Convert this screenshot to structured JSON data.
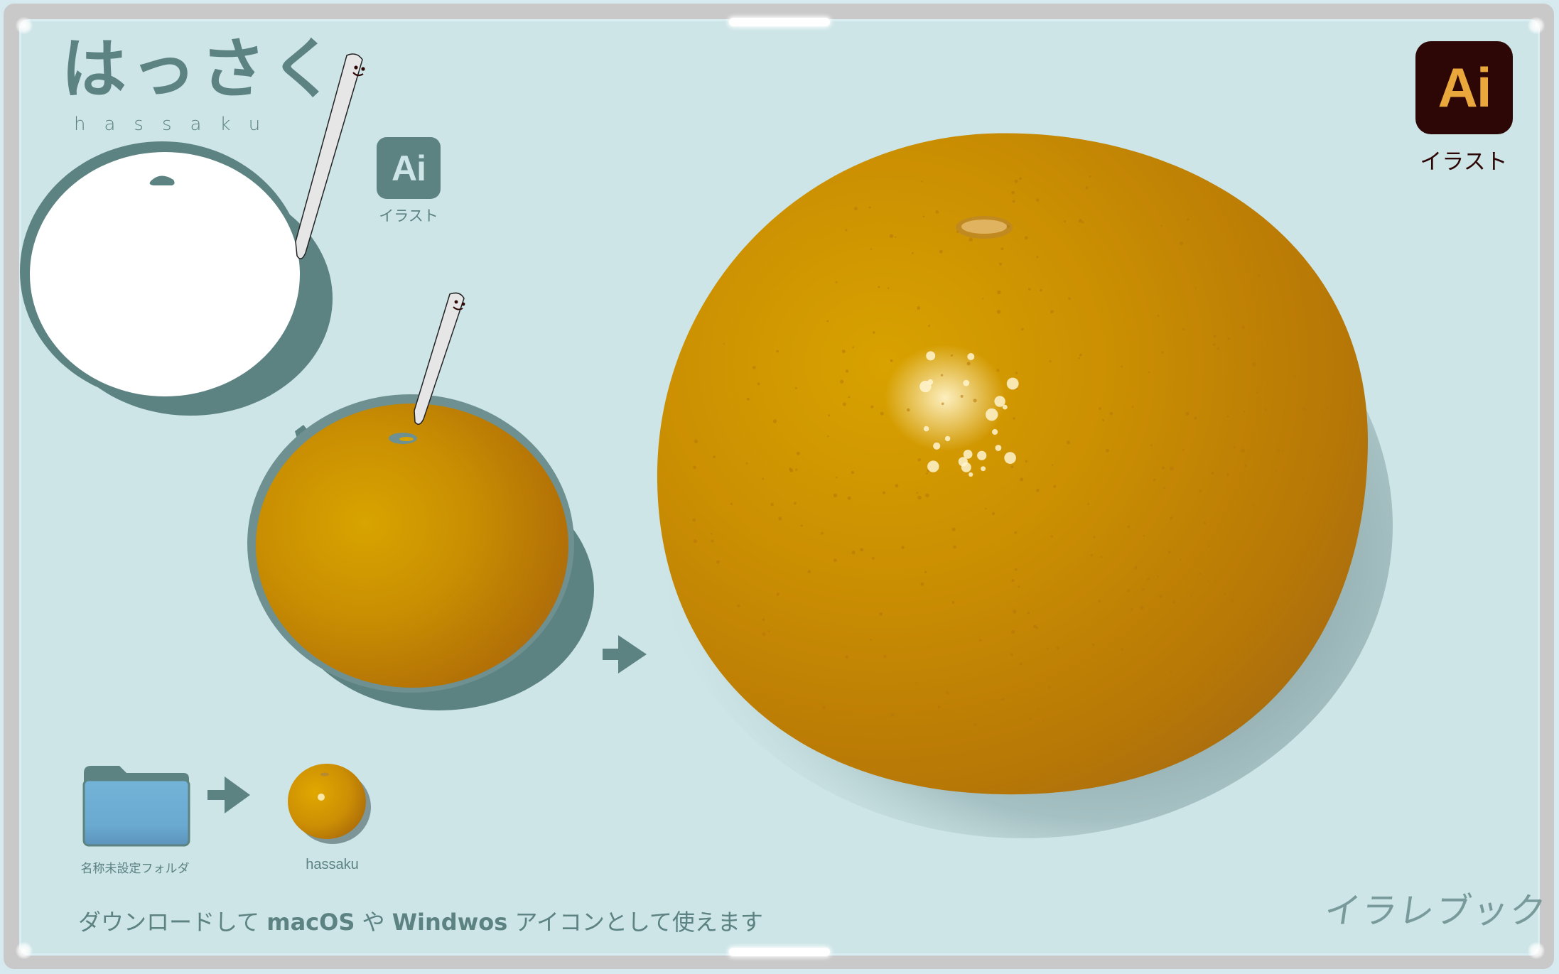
{
  "header": {
    "title_jp": "はっさく",
    "title_romaji": "hassaku"
  },
  "ai_badge_small": {
    "icon_text": "Ai",
    "label": "イラスト",
    "color": "#5c8282"
  },
  "ai_badge_large": {
    "icon_text": "Ai",
    "label": "イラスト",
    "bg_color": "#2d0606",
    "text_color": "#e9a73c"
  },
  "conversion": {
    "folder_label": "名称未設定フォルダ",
    "icon_label": "hassaku"
  },
  "footer": {
    "text_1": "ダウンロードして ",
    "text_bold_1": "macOS",
    "text_2": " や ",
    "text_bold_2": "Windwos",
    "text_3": " アイコンとして使えます"
  },
  "watermark": "イラレブック",
  "colors": {
    "background": "#cde5e7",
    "accent": "#5c8282",
    "orange_light": "#d6a200",
    "orange_dark": "#b06f08",
    "frame_gray": "#c9c9c9"
  }
}
